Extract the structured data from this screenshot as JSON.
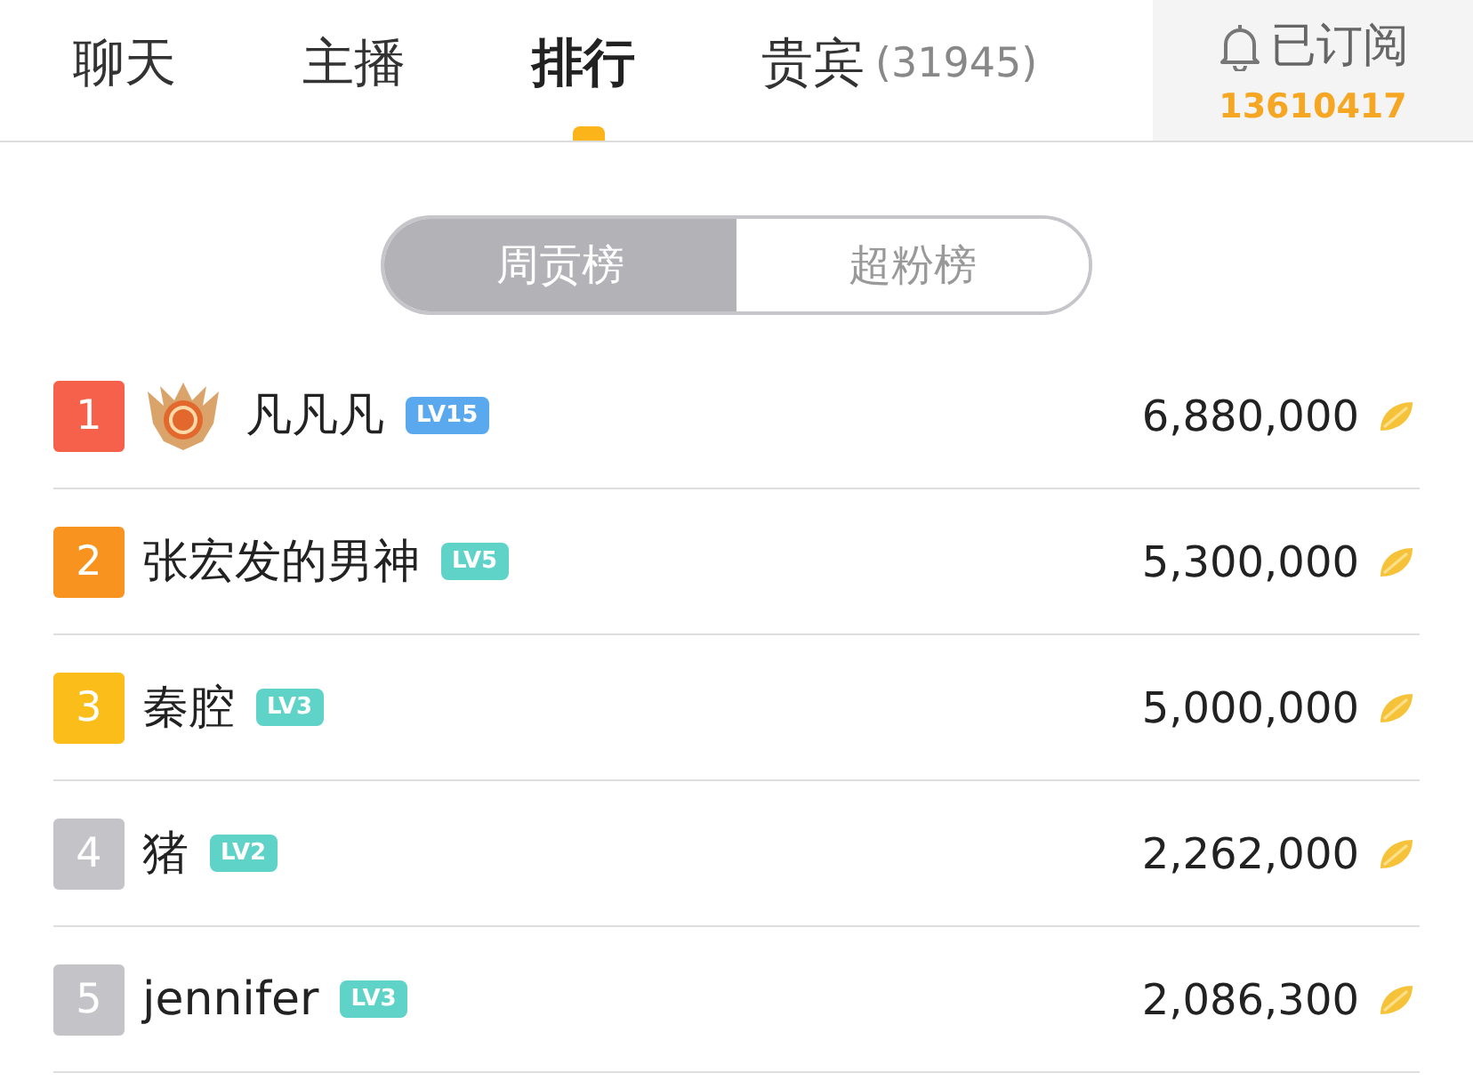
{
  "tabs": [
    {
      "label": "聊天",
      "selected": false
    },
    {
      "label": "主播",
      "selected": false
    },
    {
      "label": "排行",
      "selected": true
    },
    {
      "label": "贵宾",
      "count": "(31945)",
      "selected": false
    }
  ],
  "subscribe": {
    "label": "已订阅",
    "count": "13610417"
  },
  "segments": [
    {
      "label": "周贡榜",
      "selected": true
    },
    {
      "label": "超粉榜",
      "selected": false
    }
  ],
  "rows": [
    {
      "rank": "1",
      "color": "#f5614a",
      "crest": true,
      "name": "凡凡凡",
      "level": {
        "text": "LV15",
        "color": "#5aa9ef"
      },
      "amount": "6,880,000"
    },
    {
      "rank": "2",
      "color": "#f7931e",
      "crest": false,
      "name": "张宏发的男神",
      "level": {
        "text": "LV5",
        "color": "#5fd3c8"
      },
      "amount": "5,300,000"
    },
    {
      "rank": "3",
      "color": "#fbbd1a",
      "crest": false,
      "name": "秦腔",
      "level": {
        "text": "LV3",
        "color": "#5fd3c8"
      },
      "amount": "5,000,000"
    },
    {
      "rank": "4",
      "color": "#c3c3c8",
      "crest": false,
      "name": "猪",
      "level": {
        "text": "LV2",
        "color": "#5fd3c8"
      },
      "amount": "2,262,000"
    },
    {
      "rank": "5",
      "color": "#c3c3c8",
      "crest": false,
      "name": "jennifer",
      "level": {
        "text": "LV3",
        "color": "#5fd3c8"
      },
      "amount": "2,086,300"
    }
  ]
}
